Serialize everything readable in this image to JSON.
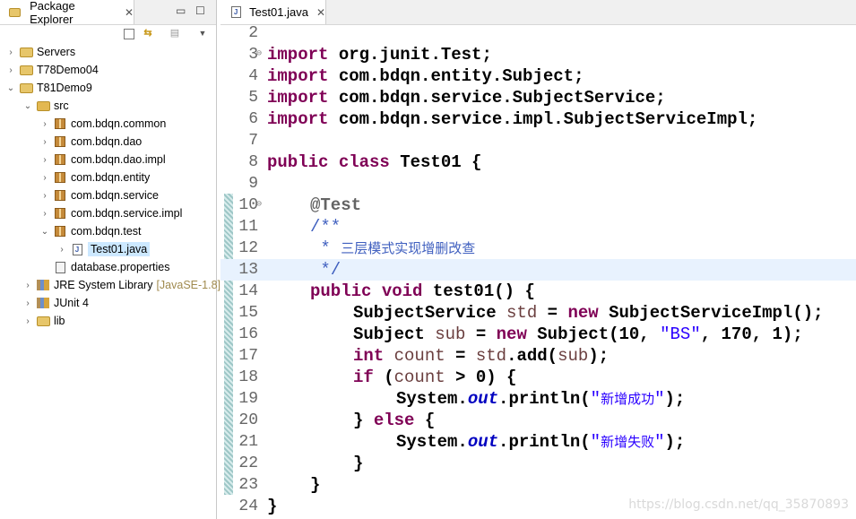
{
  "explorer": {
    "tab_label": "Package Explorer",
    "tab_close": "✕",
    "minimize": "▭",
    "maximize": "☐",
    "tree": [
      {
        "label": "Servers",
        "icon": "folder-icon",
        "arrow": "›"
      },
      {
        "label": "T78Demo04",
        "icon": "project-icon",
        "arrow": "›"
      },
      {
        "label": "T81Demo9",
        "icon": "project-icon",
        "arrow": "⌄"
      },
      {
        "label": "src",
        "icon": "source-folder-icon",
        "arrow": "⌄"
      },
      {
        "label": "com.bdqn.common",
        "icon": "package-icon",
        "arrow": "›"
      },
      {
        "label": "com.bdqn.dao",
        "icon": "package-icon",
        "arrow": "›"
      },
      {
        "label": "com.bdqn.dao.impl",
        "icon": "package-icon",
        "arrow": "›"
      },
      {
        "label": "com.bdqn.entity",
        "icon": "package-icon",
        "arrow": "›"
      },
      {
        "label": "com.bdqn.service",
        "icon": "package-icon",
        "arrow": "›"
      },
      {
        "label": "com.bdqn.service.impl",
        "icon": "package-icon",
        "arrow": "›"
      },
      {
        "label": "com.bdqn.test",
        "icon": "package-icon",
        "arrow": "⌄"
      },
      {
        "label": "Test01.java",
        "icon": "java-file-icon",
        "arrow": "›"
      },
      {
        "label": "database.properties",
        "icon": "properties-file-icon",
        "arrow": ""
      },
      {
        "label": "JRE System Library",
        "decoration": "[JavaSE-1.8]",
        "icon": "library-icon",
        "arrow": "›"
      },
      {
        "label": "JUnit 4",
        "icon": "library-icon",
        "arrow": "›"
      },
      {
        "label": "lib",
        "icon": "folder-icon",
        "arrow": "›"
      }
    ]
  },
  "editor": {
    "tab_label": "Test01.java",
    "tab_close": "✕",
    "line_numbers": [
      "2",
      "3",
      "4",
      "5",
      "6",
      "7",
      "8",
      "9",
      "10",
      "11",
      "12",
      "13",
      "14",
      "15",
      "16",
      "17",
      "18",
      "19",
      "20",
      "21",
      "22",
      "23",
      "24"
    ],
    "fold_markers": {
      "3": "⊖",
      "10": "⊖"
    },
    "code": {
      "l3_kw": "import",
      "l3_rest": " org.junit.Test;",
      "l4_kw": "import",
      "l4_rest": " com.bdqn.entity.Subject;",
      "l5_kw": "import",
      "l5_rest": " com.bdqn.service.SubjectService;",
      "l6_kw": "import",
      "l6_rest": " com.bdqn.service.impl.SubjectServiceImpl;",
      "l8_kw": "public class",
      "l8_rest": " Test01 {",
      "l10_ann": "@Test",
      "l11_doc": "/**",
      "l12_doc": " * ",
      "l12_cn": "三层模式实现增删改查",
      "l13_doc": " */",
      "l14_kw": "public void",
      "l14_rest": " test01() {",
      "l15_a": "SubjectService ",
      "l15_var": "std",
      "l15_b": " = ",
      "l15_kw": "new",
      "l15_c": " SubjectServiceImpl();",
      "l16_a": "Subject ",
      "l16_var": "sub",
      "l16_b": " = ",
      "l16_kw": "new",
      "l16_c": " Subject(10, ",
      "l16_str": "\"BS\"",
      "l16_d": ", 170, 1);",
      "l17_kw": "int",
      "l17_sp": " ",
      "l17_var": "count",
      "l17_b": " = ",
      "l17_var2": "std",
      "l17_c": ".add(",
      "l17_var3": "sub",
      "l17_d": ");",
      "l18_kw": "if",
      "l18_a": " (",
      "l18_var": "count",
      "l18_b": " > 0) {",
      "l19_a": "System.",
      "l19_field": "out",
      "l19_b": ".println(",
      "l19_q1": "\"",
      "l19_str": "新增成功",
      "l19_q2": "\"",
      "l19_c": ");",
      "l20_a": "} ",
      "l20_kw": "else",
      "l20_b": " {",
      "l21_a": "System.",
      "l21_field": "out",
      "l21_b": ".println(",
      "l21_q1": "\"",
      "l21_str": "新增失败",
      "l21_q2": "\"",
      "l21_c": ");",
      "l22": "}",
      "l23": "}",
      "l24": "}"
    }
  },
  "watermark": "https://blog.csdn.net/qq_35870893",
  "colors": {
    "keyword": "#7f0055",
    "string": "#2a00ff",
    "javadoc": "#3f5fbf",
    "variable": "#6a3e3e",
    "field": "#0000c0",
    "selection": "#cce8ff",
    "current_line": "#e8f2fe"
  }
}
